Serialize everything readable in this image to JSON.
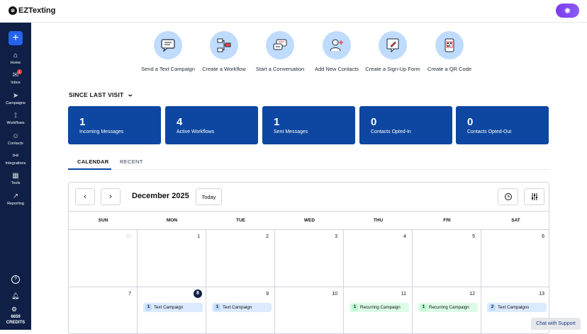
{
  "header": {
    "logo_text": "EZTexting"
  },
  "sidebar": {
    "new_button": "+",
    "items": [
      {
        "label": "Home",
        "icon": "⌂"
      },
      {
        "label": "Inbox",
        "icon": "✉",
        "badge": "1"
      },
      {
        "label": "Campaigns",
        "icon": "➤"
      },
      {
        "label": "Workflows",
        "icon": "⟟"
      },
      {
        "label": "Contacts",
        "icon": "☺"
      },
      {
        "label": "Integrations",
        "icon": "⚯"
      },
      {
        "label": "Tools",
        "icon": "▦"
      },
      {
        "label": "Reporting",
        "icon": "↗"
      }
    ],
    "help_glyph": "?",
    "credits_count": "6659",
    "credits_label": "CREDITS"
  },
  "quick_actions": [
    {
      "label": "Send a Text Campaign",
      "icon": "chat-bubble-icon"
    },
    {
      "label": "Create a Workflow",
      "icon": "workflow-icon"
    },
    {
      "label": "Start a Conversation",
      "icon": "conversation-icon"
    },
    {
      "label": "Add New Contacts",
      "icon": "add-contact-icon"
    },
    {
      "label": "Create a Sign-Up Form",
      "icon": "signup-form-icon"
    },
    {
      "label": "Create a QR Code",
      "icon": "qr-code-icon"
    }
  ],
  "since_last_visit": "SINCE LAST VISIT",
  "stats": [
    {
      "value": "1",
      "label": "Incoming Messages"
    },
    {
      "value": "4",
      "label": "Active Workflows"
    },
    {
      "value": "1",
      "label": "Sent Messages"
    },
    {
      "value": "0",
      "label": "Contacts Opted-In"
    },
    {
      "value": "0",
      "label": "Contacts Opted-Out"
    }
  ],
  "tabs": {
    "calendar": "CALENDAR",
    "recent": "RECENT"
  },
  "calendar": {
    "prev": "‹",
    "next": "›",
    "month": "December 2025",
    "today_label": "Today",
    "days_of_week": [
      "SUN",
      "MON",
      "TUE",
      "WED",
      "THU",
      "FRI",
      "SAT"
    ],
    "week1": [
      "30",
      "1",
      "2",
      "3",
      "4",
      "5",
      "6"
    ],
    "week2": [
      "7",
      "8",
      "9",
      "10",
      "11",
      "12",
      "13"
    ],
    "events": {
      "mon": {
        "count": "1",
        "label": "Text Campaign"
      },
      "tue": {
        "count": "1",
        "label": "Text Campaign"
      },
      "thu": {
        "count": "1",
        "label": "Recurring Campaign"
      },
      "fri": {
        "count": "1",
        "label": "Recurring Campaign"
      },
      "sat": {
        "count": "2",
        "label": "Text Campaigns"
      }
    }
  },
  "chat_support": "Chat with Support",
  "colors": {
    "brand_navy": "#0f1f45",
    "stat_blue": "#0d47a1",
    "accent_purple": "#7c3aed"
  }
}
